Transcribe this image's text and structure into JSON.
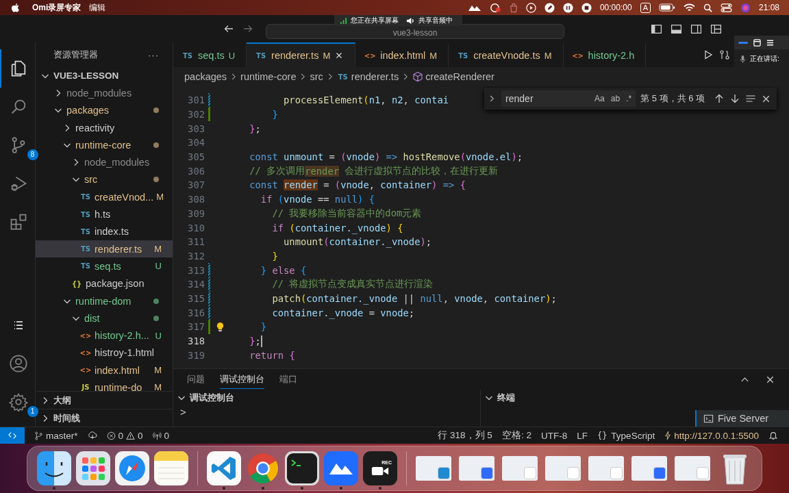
{
  "menubar": {
    "app_name": "Omi录屏专家",
    "menus": [
      "编辑"
    ],
    "timer": "00:00:00",
    "input_source": "A",
    "clock": "21:08"
  },
  "share_indicator": {
    "screen": "您正在共享屏幕",
    "audio": "共享音频中"
  },
  "speaking_indicator": {
    "label": "正在讲话:"
  },
  "titlebar": {
    "navigation": [
      {
        "kind": "back",
        "disabled": false
      },
      {
        "kind": "forward",
        "disabled": true
      }
    ],
    "command_center": "vue3-lesson"
  },
  "activity_bar": {
    "items": [
      {
        "kind": "files",
        "selected": true
      },
      {
        "kind": "search",
        "selected": false
      },
      {
        "kind": "source-control",
        "selected": false,
        "badge": "8"
      },
      {
        "kind": "run-debug",
        "selected": false
      },
      {
        "kind": "extensions",
        "selected": false
      }
    ],
    "bottom": [
      {
        "kind": "list"
      },
      {
        "kind": "account"
      },
      {
        "kind": "settings",
        "badge": "1"
      }
    ]
  },
  "explorer": {
    "title": "资源管理器",
    "more": "···",
    "root": "VUE3-LESSON",
    "root_expanded": true,
    "tree": [
      {
        "label": "node_modules",
        "kind": "folder",
        "expanded": false,
        "color": "#8c8c8c",
        "changes": false,
        "selected": false
      },
      {
        "label": "packages",
        "kind": "folder",
        "expanded": true,
        "color": "#e2c08d",
        "changes": true,
        "selected": false,
        "children": [
          {
            "label": "reactivity",
            "kind": "folder",
            "expanded": false,
            "color": "#cccccc",
            "changes": false,
            "selected": false
          },
          {
            "label": "runtime-core",
            "kind": "folder",
            "expanded": true,
            "color": "#e2c08d",
            "changes": true,
            "selected": false,
            "children": [
              {
                "label": "node_modules",
                "kind": "folder",
                "expanded": false,
                "color": "#8c8c8c",
                "changes": false,
                "selected": false
              },
              {
                "label": "src",
                "kind": "folder",
                "expanded": true,
                "color": "#e2c08d",
                "changes": true,
                "selected": false,
                "children": [
                  {
                    "label": "createVnod...",
                    "kind": "ts",
                    "icon": "TS",
                    "badge": "M",
                    "color": "#e2c08d",
                    "selected": false
                  },
                  {
                    "label": "h.ts",
                    "kind": "ts",
                    "icon": "TS",
                    "color": "#cccccc",
                    "selected": false
                  },
                  {
                    "label": "index.ts",
                    "kind": "ts",
                    "icon": "TS",
                    "color": "#cccccc",
                    "selected": false
                  },
                  {
                    "label": "renderer.ts",
                    "kind": "ts",
                    "icon": "TS",
                    "badge": "M",
                    "color": "#e2c08d",
                    "selected": true
                  },
                  {
                    "label": "seq.ts",
                    "kind": "ts",
                    "icon": "TS",
                    "badge": "U",
                    "color": "#73c991",
                    "selected": false
                  }
                ]
              },
              {
                "label": "package.json",
                "kind": "json",
                "icon": "{}",
                "color": "#cccccc",
                "selected": false
              }
            ]
          },
          {
            "label": "runtime-dom",
            "kind": "folder",
            "expanded": true,
            "color": "#73c991",
            "changes": true,
            "selected": false,
            "children": [
              {
                "label": "dist",
                "kind": "folder",
                "expanded": true,
                "color": "#73c991",
                "changes": true,
                "selected": false,
                "children": [
                  {
                    "label": "history-2.h...",
                    "kind": "html",
                    "icon": "<>",
                    "badge": "U",
                    "color": "#73c991",
                    "selected": false
                  },
                  {
                    "label": "histroy-1.html",
                    "kind": "html",
                    "icon": "<>",
                    "color": "#cccccc",
                    "selected": false
                  },
                  {
                    "label": "index.html",
                    "kind": "html",
                    "icon": "<>",
                    "badge": "M",
                    "color": "#e2c08d",
                    "selected": false
                  },
                  {
                    "label": "runtime-do",
                    "kind": "js",
                    "icon": "JS",
                    "badge": "M",
                    "color": "#e2c08d",
                    "selected": false
                  }
                ]
              }
            ]
          }
        ]
      }
    ],
    "sections": [
      {
        "label": "大纲",
        "expanded": false
      },
      {
        "label": "时间线",
        "expanded": false
      }
    ]
  },
  "tabs": [
    {
      "label": "seq.ts",
      "kind": "ts",
      "icon": "TS",
      "badge": "U",
      "color": "#73c991",
      "selected": false
    },
    {
      "label": "renderer.ts",
      "kind": "ts",
      "icon": "TS",
      "badge": "M",
      "color": "#e2c08d",
      "selected": true
    },
    {
      "label": "index.html",
      "kind": "html",
      "icon": "<>",
      "badge": "M",
      "color": "#e2c08d",
      "selected": false
    },
    {
      "label": "createVnode.ts",
      "kind": "ts",
      "icon": "TS",
      "badge": "M",
      "color": "#e2c08d",
      "selected": false
    },
    {
      "label": "history-2.h",
      "kind": "html",
      "icon": "<>",
      "color": "#73c991",
      "selected": false
    }
  ],
  "breadcrumb": [
    {
      "label": "packages",
      "kind": "folder"
    },
    {
      "label": "runtime-core",
      "kind": "folder"
    },
    {
      "label": "src",
      "kind": "folder"
    },
    {
      "label": "renderer.ts",
      "kind": "ts",
      "icon": "TS"
    },
    {
      "label": "createRenderer",
      "kind": "symbol"
    }
  ],
  "find_widget": {
    "query": "render",
    "options": [
      "Aa",
      "ab",
      ".*"
    ],
    "count": "第 5 项，共 6 项"
  },
  "editor": {
    "lines": [
      {
        "number": "301",
        "modified": true,
        "added": false,
        "current": false,
        "lightbulb": false,
        "tokens": [
          {
            "kind": "function",
            "text": "          processElement"
          },
          {
            "kind": "bracket1",
            "text": "("
          },
          {
            "kind": "variable",
            "text": "n1"
          },
          {
            "kind": "plain",
            "text": ", "
          },
          {
            "kind": "variable",
            "text": "n2"
          },
          {
            "kind": "plain",
            "text": ", "
          },
          {
            "kind": "variable",
            "text": "contai"
          }
        ]
      },
      {
        "number": "302",
        "modified": false,
        "added": true,
        "current": false,
        "lightbulb": false,
        "tokens": [
          {
            "kind": "bracket3",
            "text": "        }"
          }
        ]
      },
      {
        "number": "303",
        "modified": false,
        "added": false,
        "current": false,
        "lightbulb": false,
        "tokens": [
          {
            "kind": "bracket2",
            "text": "    }"
          },
          {
            "kind": "plain",
            "text": ";"
          }
        ]
      },
      {
        "number": "304",
        "modified": false,
        "added": false,
        "current": false,
        "lightbulb": false
      },
      {
        "number": "305",
        "modified": false,
        "added": false,
        "current": false,
        "lightbulb": false,
        "tokens": [
          {
            "kind": "keyword",
            "text": "    const"
          },
          {
            "kind": "variable",
            "text": " unmount"
          },
          {
            "kind": "plain",
            "text": " = "
          },
          {
            "kind": "bracket2",
            "text": "("
          },
          {
            "kind": "variable",
            "text": "vnode"
          },
          {
            "kind": "bracket2",
            "text": ")"
          },
          {
            "kind": "keyword",
            "text": " => "
          },
          {
            "kind": "function",
            "text": "hostRemove"
          },
          {
            "kind": "bracket2",
            "text": "("
          },
          {
            "kind": "variable",
            "text": "vnode.el"
          },
          {
            "kind": "bracket2",
            "text": ")"
          },
          {
            "kind": "plain",
            "text": ";"
          }
        ]
      },
      {
        "number": "306",
        "modified": false,
        "added": false,
        "current": false,
        "lightbulb": false,
        "tokens": [
          {
            "kind": "comment",
            "text": "    // 多次调用"
          },
          {
            "kind": "comment",
            "text": "render",
            "match": true,
            "current_match": false
          },
          {
            "kind": "comment",
            "text": " 会进行虚拟节点的比较，在进行更新"
          }
        ]
      },
      {
        "number": "307",
        "modified": false,
        "added": false,
        "current": false,
        "lightbulb": false,
        "tokens": [
          {
            "kind": "keyword",
            "text": "    const "
          },
          {
            "kind": "variable",
            "text": "render",
            "match": true,
            "current_match": true
          },
          {
            "kind": "plain",
            "text": " = "
          },
          {
            "kind": "bracket2",
            "text": "("
          },
          {
            "kind": "variable",
            "text": "vnode"
          },
          {
            "kind": "plain",
            "text": ", "
          },
          {
            "kind": "variable",
            "text": "container"
          },
          {
            "kind": "bracket2",
            "text": ")"
          },
          {
            "kind": "keyword",
            "text": " => "
          },
          {
            "kind": "bracket2",
            "text": "{"
          }
        ]
      },
      {
        "number": "308",
        "modified": false,
        "added": false,
        "current": false,
        "lightbulb": false,
        "tokens": [
          {
            "kind": "control",
            "text": "      if "
          },
          {
            "kind": "bracket3",
            "text": "("
          },
          {
            "kind": "variable",
            "text": "vnode"
          },
          {
            "kind": "plain",
            "text": " == "
          },
          {
            "kind": "keyword",
            "text": "null"
          },
          {
            "kind": "bracket3",
            "text": ")"
          },
          {
            "kind": "bracket3",
            "text": " {"
          }
        ]
      },
      {
        "number": "309",
        "modified": false,
        "added": false,
        "current": false,
        "lightbulb": false,
        "tokens": [
          {
            "kind": "comment",
            "text": "        // 我要移除当前容器中的dom元素"
          }
        ]
      },
      {
        "number": "310",
        "modified": false,
        "added": false,
        "current": false,
        "lightbulb": false,
        "tokens": [
          {
            "kind": "control",
            "text": "        if "
          },
          {
            "kind": "bracket1",
            "text": "("
          },
          {
            "kind": "variable",
            "text": "container._vnode"
          },
          {
            "kind": "bracket1",
            "text": ")"
          },
          {
            "kind": "bracket1",
            "text": " {"
          }
        ]
      },
      {
        "number": "311",
        "modified": false,
        "added": false,
        "current": false,
        "lightbulb": false,
        "tokens": [
          {
            "kind": "function",
            "text": "          unmount"
          },
          {
            "kind": "bracket2",
            "text": "("
          },
          {
            "kind": "variable",
            "text": "container._vnode"
          },
          {
            "kind": "bracket2",
            "text": ")"
          },
          {
            "kind": "plain",
            "text": ";"
          }
        ]
      },
      {
        "number": "312",
        "modified": false,
        "added": false,
        "current": false,
        "lightbulb": false,
        "tokens": [
          {
            "kind": "bracket1",
            "text": "        }"
          }
        ]
      },
      {
        "number": "313",
        "modified": true,
        "added": false,
        "current": false,
        "lightbulb": false,
        "tokens": [
          {
            "kind": "bracket3",
            "text": "      } "
          },
          {
            "kind": "control",
            "text": "else"
          },
          {
            "kind": "bracket3",
            "text": " {"
          }
        ]
      },
      {
        "number": "314",
        "modified": true,
        "added": false,
        "current": false,
        "lightbulb": false,
        "tokens": [
          {
            "kind": "comment",
            "text": "        // 将虚拟节点变成真实节点进行渲染"
          }
        ]
      },
      {
        "number": "315",
        "modified": true,
        "added": false,
        "current": false,
        "lightbulb": false,
        "tokens": [
          {
            "kind": "function",
            "text": "        patch"
          },
          {
            "kind": "bracket1",
            "text": "("
          },
          {
            "kind": "variable",
            "text": "container._vnode"
          },
          {
            "kind": "plain",
            "text": " || "
          },
          {
            "kind": "keyword",
            "text": "null"
          },
          {
            "kind": "plain",
            "text": ", "
          },
          {
            "kind": "variable",
            "text": "vnode"
          },
          {
            "kind": "plain",
            "text": ", "
          },
          {
            "kind": "variable",
            "text": "container"
          },
          {
            "kind": "bracket1",
            "text": ")"
          },
          {
            "kind": "plain",
            "text": ";"
          }
        ]
      },
      {
        "number": "316",
        "modified": true,
        "added": false,
        "current": false,
        "lightbulb": false,
        "tokens": [
          {
            "kind": "variable",
            "text": "        container._vnode"
          },
          {
            "kind": "plain",
            "text": " = "
          },
          {
            "kind": "variable",
            "text": "vnode"
          },
          {
            "kind": "plain",
            "text": ";"
          }
        ]
      },
      {
        "number": "317",
        "modified": false,
        "added": true,
        "current": false,
        "lightbulb": true,
        "tokens": [
          {
            "kind": "bracket3",
            "text": "      }"
          }
        ]
      },
      {
        "number": "318",
        "modified": false,
        "added": false,
        "current": true,
        "lightbulb": false,
        "tokens": [
          {
            "kind": "bracket2",
            "text": "    }"
          },
          {
            "kind": "plain",
            "text": ";"
          }
        ]
      },
      {
        "number": "319",
        "modified": false,
        "added": false,
        "current": false,
        "lightbulb": false,
        "tokens": [
          {
            "kind": "control",
            "text": "    return"
          },
          {
            "kind": "bracket2",
            "text": " {"
          }
        ]
      }
    ]
  },
  "panel": {
    "tabs": [
      {
        "label": "问题",
        "selected": false
      },
      {
        "label": "调试控制台",
        "selected": true
      },
      {
        "label": "端口",
        "selected": false
      }
    ],
    "sections": [
      {
        "label": "调试控制台",
        "expanded": true
      },
      {
        "label": "终端",
        "expanded": true
      }
    ],
    "prompt": ">",
    "terminals": [
      {
        "label": "Five Server",
        "selected": true
      }
    ]
  },
  "status_bar": {
    "branch": "master*",
    "errors": "0",
    "warnings": "0",
    "ports": "0",
    "position": "行 318，列 5",
    "indent": "空格: 2",
    "encoding": "UTF-8",
    "eol": "LF",
    "language_icon": "{}",
    "language": "TypeScript",
    "server": "http://127.0.0.1:5500"
  },
  "dock": {
    "apps": [
      {
        "kind": "finder",
        "running": true
      },
      {
        "kind": "launchpad",
        "running": false
      },
      {
        "kind": "safari",
        "running": false
      },
      {
        "kind": "notes",
        "running": false
      },
      {
        "kind": "vscode",
        "running": true
      },
      {
        "kind": "chrome",
        "running": true
      },
      {
        "kind": "terminal",
        "running": true
      },
      {
        "kind": "lark",
        "running": true
      },
      {
        "kind": "recorder",
        "running": true,
        "text": "REC"
      }
    ],
    "windows": [
      {
        "kind": "vscode"
      },
      {
        "kind": "lark"
      },
      {
        "kind": "chrome"
      },
      {
        "kind": "chrome"
      },
      {
        "kind": "chrome"
      },
      {
        "kind": "lark"
      },
      {
        "kind": "chrome"
      }
    ]
  }
}
